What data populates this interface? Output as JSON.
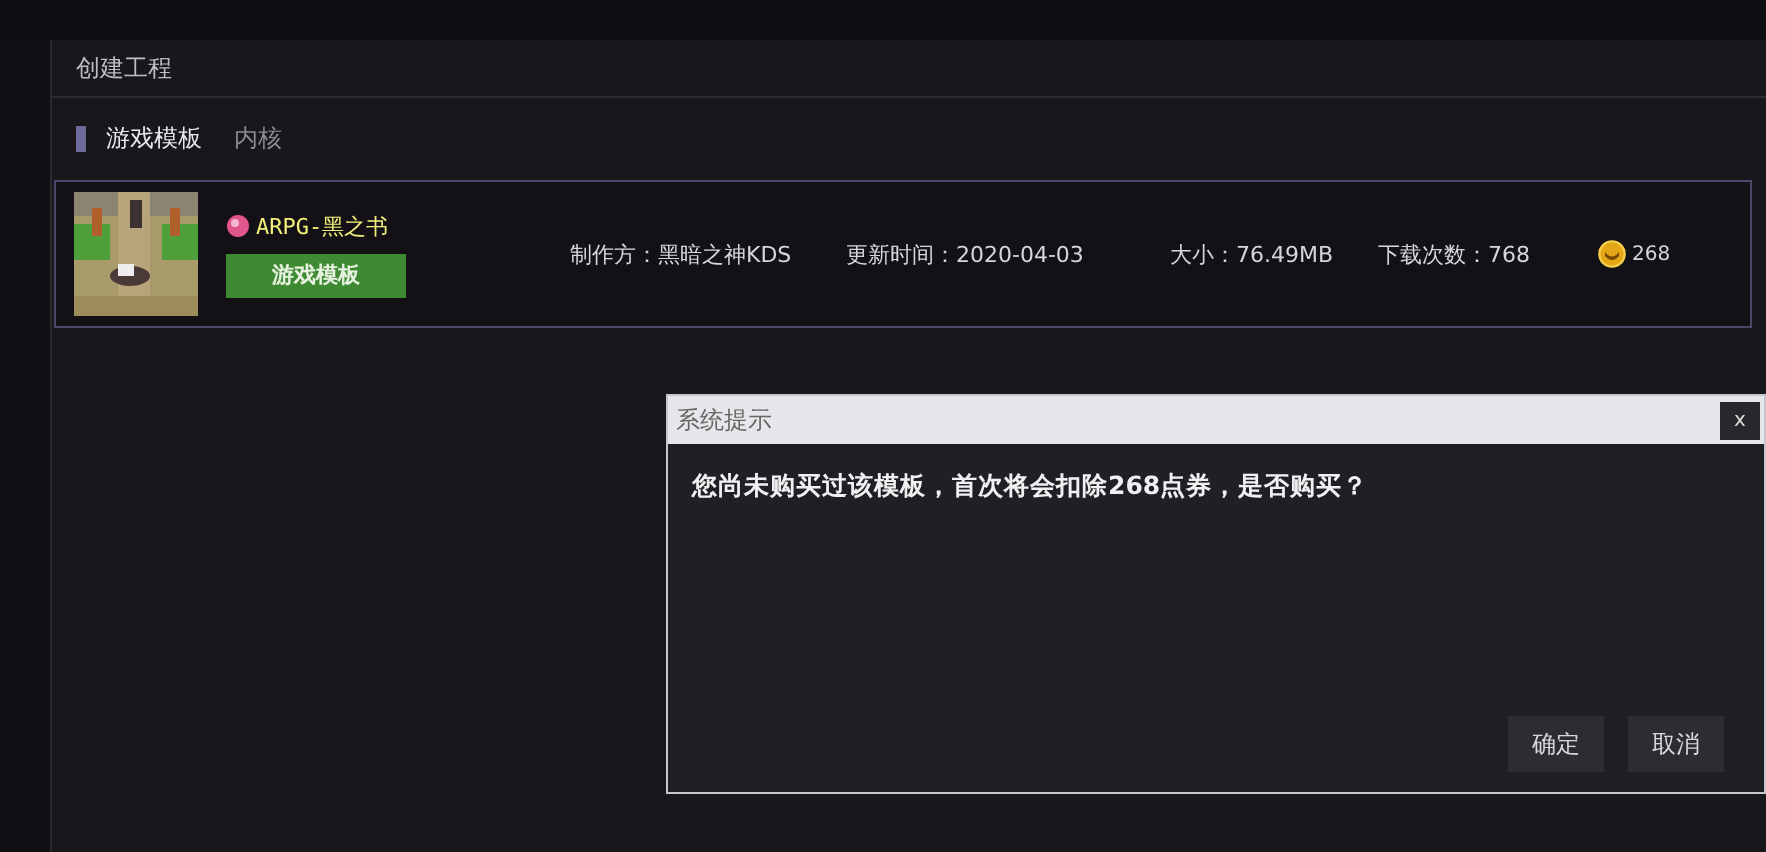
{
  "panel": {
    "title": "创建工程"
  },
  "tabs": [
    {
      "label": "游戏模板",
      "selected": true
    },
    {
      "label": "内核",
      "selected": false
    }
  ],
  "templates": [
    {
      "name": "ARPG-黑之书",
      "tag": "游戏模板",
      "maker": "制作方：黑暗之神KDS",
      "updated": "更新时间：2020-04-03",
      "size": "大小：76.49MB",
      "downloads": "下载次数：768",
      "price": "268"
    }
  ],
  "dialog": {
    "title": "系统提示",
    "close": "x",
    "message": "您尚未购买过该模板，首次将会扣除268点券，是否购买？",
    "buttons": [
      "确定",
      "取消"
    ]
  }
}
